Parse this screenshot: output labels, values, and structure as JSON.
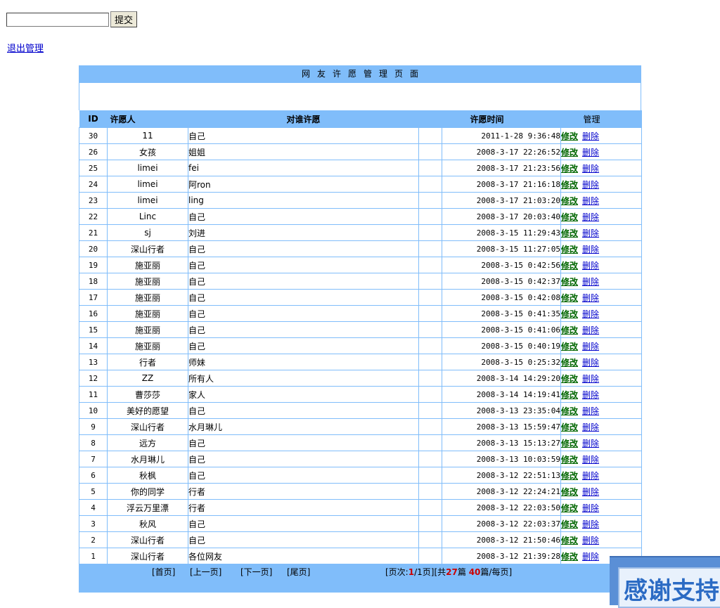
{
  "form": {
    "input_value": "",
    "submit_label": "提交"
  },
  "logout_label": "退出管理",
  "panel_title": "网友许愿管理页面",
  "headers": {
    "id": "ID",
    "name": "许愿人",
    "target": "对谁许愿",
    "time": "许愿时间",
    "manage": "管理"
  },
  "actions": {
    "edit": "修改",
    "delete": "删除"
  },
  "rows": [
    {
      "id": "30",
      "name": "11",
      "target": "自己",
      "time": "2011-1-28 9:36:48"
    },
    {
      "id": "26",
      "name": "女孩",
      "target": "姐姐",
      "time": "2008-3-17 22:26:52"
    },
    {
      "id": "25",
      "name": "limei",
      "target": "fei",
      "time": "2008-3-17 21:23:56"
    },
    {
      "id": "24",
      "name": "limei",
      "target": "阿ron",
      "time": "2008-3-17 21:16:18"
    },
    {
      "id": "23",
      "name": "limei",
      "target": "ling",
      "time": "2008-3-17 21:03:20"
    },
    {
      "id": "22",
      "name": "Linc",
      "target": "自己",
      "time": "2008-3-17 20:03:40"
    },
    {
      "id": "21",
      "name": "sj",
      "target": "刘进",
      "time": "2008-3-15 11:29:43"
    },
    {
      "id": "20",
      "name": "深山行者",
      "target": "自己",
      "time": "2008-3-15 11:27:05"
    },
    {
      "id": "19",
      "name": "施亚丽",
      "target": "自己",
      "time": "2008-3-15 0:42:56"
    },
    {
      "id": "18",
      "name": "施亚丽",
      "target": "自己",
      "time": "2008-3-15 0:42:37"
    },
    {
      "id": "17",
      "name": "施亚丽",
      "target": "自己",
      "time": "2008-3-15 0:42:08"
    },
    {
      "id": "16",
      "name": "施亚丽",
      "target": "自己",
      "time": "2008-3-15 0:41:35"
    },
    {
      "id": "15",
      "name": "施亚丽",
      "target": "自己",
      "time": "2008-3-15 0:41:06"
    },
    {
      "id": "14",
      "name": "施亚丽",
      "target": "自己",
      "time": "2008-3-15 0:40:19"
    },
    {
      "id": "13",
      "name": "行者",
      "target": "师妹",
      "time": "2008-3-15 0:25:32"
    },
    {
      "id": "12",
      "name": "ZZ",
      "target": "所有人",
      "time": "2008-3-14 14:29:20"
    },
    {
      "id": "11",
      "name": "曹莎莎",
      "target": "家人",
      "time": "2008-3-14 14:19:41"
    },
    {
      "id": "10",
      "name": "美好的愿望",
      "target": "自己",
      "time": "2008-3-13 23:35:04"
    },
    {
      "id": "9",
      "name": "深山行者",
      "target": "水月琳儿",
      "time": "2008-3-13 15:59:47"
    },
    {
      "id": "8",
      "name": "远方",
      "target": "自己",
      "time": "2008-3-13 15:13:27"
    },
    {
      "id": "7",
      "name": "水月琳儿",
      "target": "自己",
      "time": "2008-3-13 10:03:59"
    },
    {
      "id": "6",
      "name": "秋枫",
      "target": "自己",
      "time": "2008-3-12 22:51:13"
    },
    {
      "id": "5",
      "name": "你的同学",
      "target": "行者",
      "time": "2008-3-12 22:24:21"
    },
    {
      "id": "4",
      "name": "浮云万里漂",
      "target": "行者",
      "time": "2008-3-12 22:03:50"
    },
    {
      "id": "3",
      "name": "秋风",
      "target": "自己",
      "time": "2008-3-12 22:03:37"
    },
    {
      "id": "2",
      "name": "深山行者",
      "target": "自己",
      "time": "2008-3-12 21:50:46"
    },
    {
      "id": "1",
      "name": "深山行者",
      "target": "各位网友",
      "time": "2008-3-12 21:39:28"
    }
  ],
  "pager": {
    "first": "[首页]",
    "prev": "[上一页]",
    "next": "[下一页]",
    "last": "[尾页]",
    "page_prefix": "[页次:",
    "page_current": "1",
    "page_total": "/1页]",
    "total_prefix": "[共",
    "total_count": "27",
    "total_suffix": "篇",
    "per_page_count": "40",
    "per_page_suffix": "篇/每页]"
  },
  "banner_text": "感谢支持"
}
